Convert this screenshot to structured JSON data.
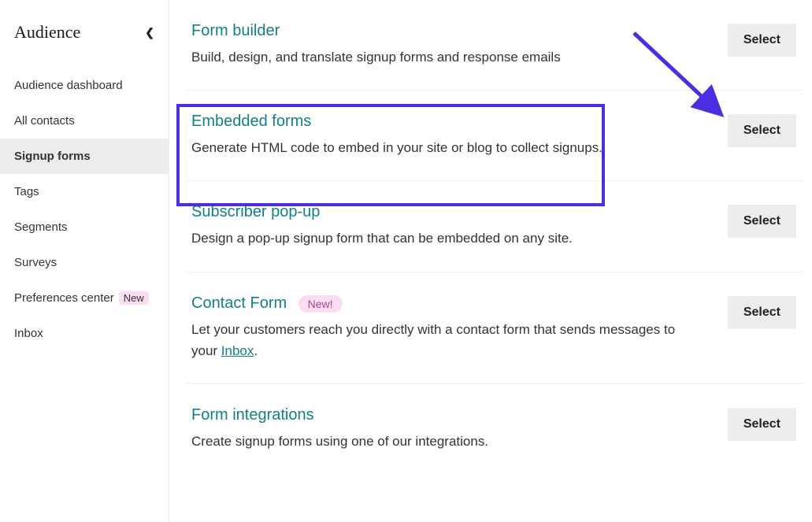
{
  "sidebar": {
    "title": "Audience",
    "items": [
      {
        "label": "Audience dashboard",
        "active": false,
        "badge": null
      },
      {
        "label": "All contacts",
        "active": false,
        "badge": null
      },
      {
        "label": "Signup forms",
        "active": true,
        "badge": null
      },
      {
        "label": "Tags",
        "active": false,
        "badge": null
      },
      {
        "label": "Segments",
        "active": false,
        "badge": null
      },
      {
        "label": "Surveys",
        "active": false,
        "badge": null
      },
      {
        "label": "Preferences center",
        "active": false,
        "badge": "New"
      },
      {
        "label": "Inbox",
        "active": false,
        "badge": null
      }
    ]
  },
  "cards": [
    {
      "title": "Form builder",
      "desc": "Build, design, and translate signup forms and response emails",
      "pill": null,
      "button": "Select"
    },
    {
      "title": "Embedded forms",
      "desc": "Generate HTML code to embed in your site or blog to collect signups.",
      "pill": null,
      "button": "Select"
    },
    {
      "title": "Subscriber pop-up",
      "desc": "Design a pop-up signup form that can be embedded on any site.",
      "pill": null,
      "button": "Select"
    },
    {
      "title": "Contact Form",
      "desc_pre": "Let your customers reach you directly with a contact form that sends messages to your ",
      "desc_link": "Inbox",
      "desc_post": ".",
      "pill": "New!",
      "button": "Select"
    },
    {
      "title": "Form integrations",
      "desc": "Create signup forms using one of our integrations.",
      "pill": null,
      "button": "Select"
    }
  ]
}
